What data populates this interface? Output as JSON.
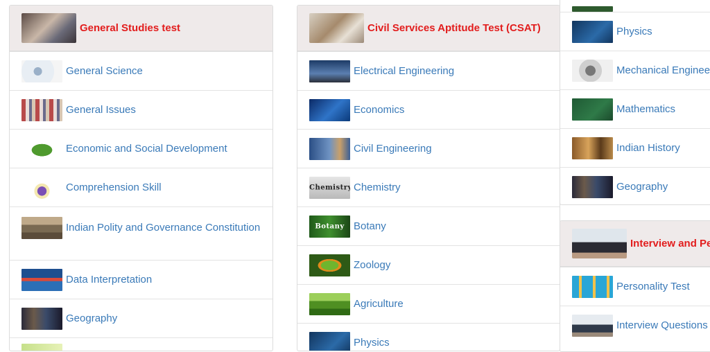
{
  "panels": {
    "general_studies": {
      "title": "General Studies test",
      "items": [
        {
          "label": "General Science"
        },
        {
          "label": "General Issues"
        },
        {
          "label": "Economic and Social Development"
        },
        {
          "label": "Comprehension Skill"
        },
        {
          "label": "Indian Polity and Governance Constitution"
        },
        {
          "label": "Data Interpretation"
        },
        {
          "label": "Geography"
        }
      ]
    },
    "csat": {
      "title": "Civil Services Aptitude Test (CSAT)",
      "items": [
        {
          "label": "Electrical Engineering"
        },
        {
          "label": "Economics"
        },
        {
          "label": "Civil Engineering"
        },
        {
          "label": "Chemistry",
          "thumb_text": "Chemistry"
        },
        {
          "label": "Botany",
          "thumb_text": "Botany"
        },
        {
          "label": "Zoology"
        },
        {
          "label": "Agriculture"
        },
        {
          "label": "Physics"
        }
      ]
    },
    "optional": {
      "items": [
        {
          "label": "Physics"
        },
        {
          "label": "Mechanical Engineering"
        },
        {
          "label": "Mathematics"
        },
        {
          "label": "Indian History"
        },
        {
          "label": "Geography"
        }
      ]
    },
    "interview": {
      "title": "Interview and Personality",
      "items": [
        {
          "label": "Personality Test"
        },
        {
          "label": "Interview Questions"
        }
      ]
    }
  },
  "colors": {
    "title_red": "#e21d1d",
    "link_blue": "#3a7ab8",
    "header_bg": "#efeaea"
  }
}
